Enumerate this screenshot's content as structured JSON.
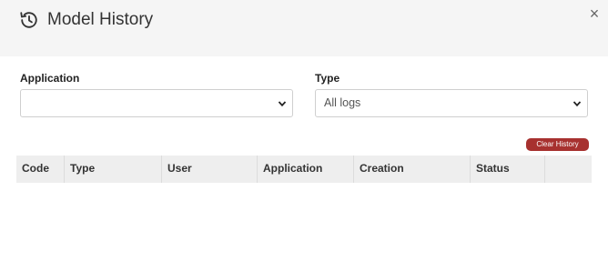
{
  "modal": {
    "title": "Model History",
    "title_icon": "history-icon",
    "close_icon": "close-icon",
    "close_glyph": "×"
  },
  "filters": {
    "application": {
      "label": "Application",
      "value": ""
    },
    "type": {
      "label": "Type",
      "value": "All logs"
    }
  },
  "actions": {
    "clear_history_label": "Clear History",
    "clear_history_color": "#a7312f"
  },
  "table": {
    "columns": [
      "Code",
      "Type",
      "User",
      "Application",
      "Creation",
      "Status",
      ""
    ],
    "rows": []
  },
  "colors": {
    "header_bg": "#f5f5f5",
    "table_header_bg": "#eeeeee"
  }
}
